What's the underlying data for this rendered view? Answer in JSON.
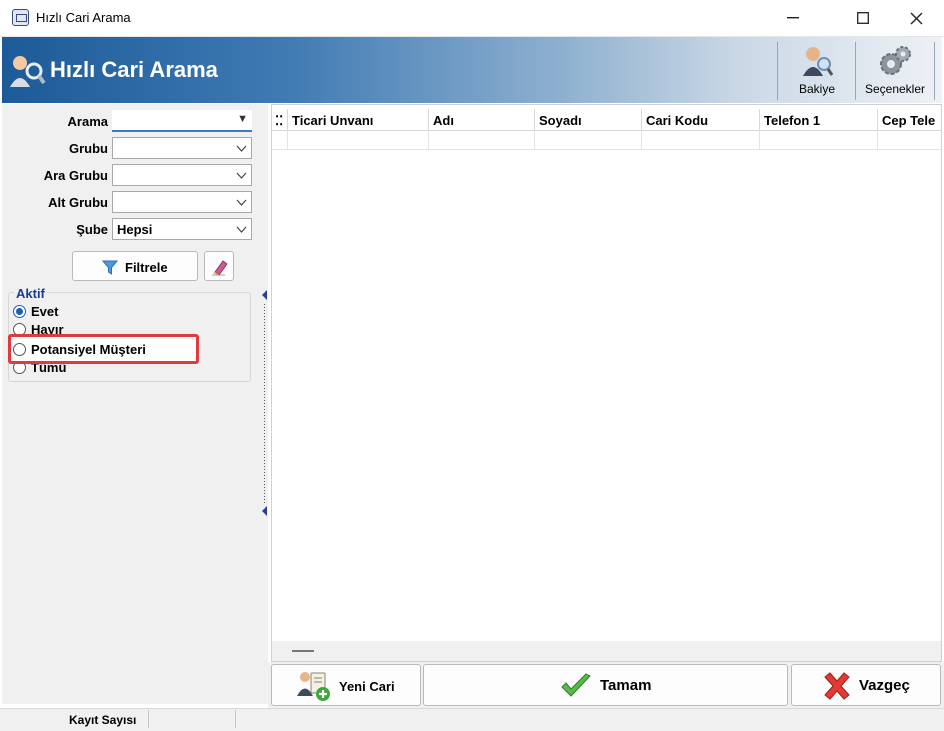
{
  "window": {
    "title": "Hızlı Cari Arama"
  },
  "header": {
    "title": "Hızlı Cari Arama"
  },
  "toolbar": {
    "bakiye_label": "Bakiye",
    "secenekler_label": "Seçenekler"
  },
  "filters": {
    "arama_label": "Arama",
    "arama_value": "",
    "grubu_label": "Grubu",
    "grubu_value": "",
    "ara_grubu_label": "Ara Grubu",
    "ara_grubu_value": "",
    "alt_grubu_label": "Alt Grubu",
    "alt_grubu_value": "",
    "sube_label": "Şube",
    "sube_value": "Hepsi",
    "filtrele_label": "Filtrele"
  },
  "aktif": {
    "title": "Aktif",
    "options": [
      "Evet",
      "Hayır",
      "Potansiyel Müşteri",
      "Tümü"
    ],
    "selected": "Evet"
  },
  "grid": {
    "columns": [
      "Ticari Unvanı",
      "Adı",
      "Soyadı",
      "Cari Kodu",
      "Telefon 1",
      "Cep Tele"
    ]
  },
  "buttons": {
    "yeni_cari": "Yeni Cari",
    "tamam": "Tamam",
    "vazgec": "Vazgeç"
  },
  "status": {
    "kayit_sayisi_label": "Kayıt Sayısı"
  },
  "colors": {
    "banner_start": "#1c5a98",
    "highlight": "#e0393e",
    "focus_underline": "#3d78c6"
  }
}
